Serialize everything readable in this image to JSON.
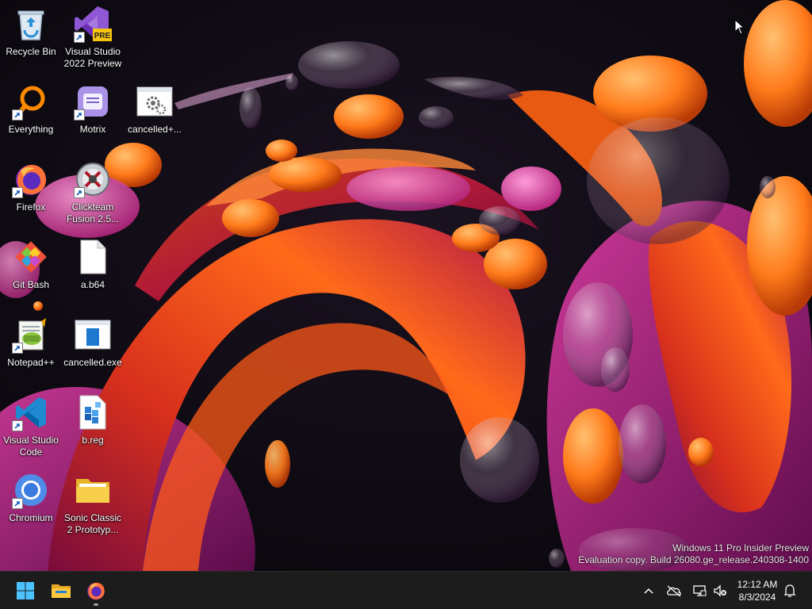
{
  "desktop": {
    "icons": [
      {
        "id": "recycle-bin",
        "label": "Recycle Bin",
        "icon": "recycle-bin-icon"
      },
      {
        "id": "visual-studio-2022-preview",
        "label": "Visual Studio 2022 Preview",
        "icon": "visual-studio-preview-icon",
        "badge": "PRE"
      },
      {
        "id": "everything",
        "label": "Everything",
        "icon": "everything-search-icon"
      },
      {
        "id": "motrix",
        "label": "Motrix",
        "icon": "motrix-icon"
      },
      {
        "id": "cancelled-plus",
        "label": "cancelled+...",
        "icon": "settings-file-icon"
      },
      {
        "id": "firefox",
        "label": "Firefox",
        "icon": "firefox-icon"
      },
      {
        "id": "clickteam-fusion",
        "label": "Clickteam Fusion 2.5...",
        "icon": "clickteam-fusion-icon"
      },
      {
        "id": "git-bash",
        "label": "Git Bash",
        "icon": "git-bash-icon"
      },
      {
        "id": "a-b64",
        "label": "a.b64",
        "icon": "blank-file-icon"
      },
      {
        "id": "notepad-plus-plus",
        "label": "Notepad++",
        "icon": "notepad-plus-plus-icon"
      },
      {
        "id": "cancelled-exe",
        "label": "cancelled.exe",
        "icon": "exe-window-icon"
      },
      {
        "id": "visual-studio-code",
        "label": "Visual Studio Code",
        "icon": "vscode-icon"
      },
      {
        "id": "b-reg",
        "label": "b.reg",
        "icon": "registry-file-icon"
      },
      {
        "id": "chromium",
        "label": "Chromium",
        "icon": "chromium-icon"
      },
      {
        "id": "sonic-classic",
        "label": "Sonic Classic 2 Prototyp...",
        "icon": "folder-icon"
      }
    ]
  },
  "watermark": {
    "line1": "Windows 11 Pro Insider Preview",
    "line2": "Evaluation copy. Build 26080.ge_release.240308-1400"
  },
  "taskbar": {
    "pinned": [
      {
        "name": "start-button",
        "icon": "windows-logo-icon"
      },
      {
        "name": "file-explorer-button",
        "icon": "folder-icon"
      },
      {
        "name": "firefox-taskbar-button",
        "icon": "firefox-icon",
        "active": true
      }
    ],
    "tray": [
      {
        "name": "show-hidden-icons-button",
        "icon": "chevron-up-icon"
      },
      {
        "name": "onedrive-status",
        "icon": "cloud-offline-icon"
      },
      {
        "name": "network-status",
        "icon": "network-icon"
      },
      {
        "name": "volume-status",
        "icon": "speaker-muted-icon"
      }
    ],
    "clock": {
      "time": "12:12 AM",
      "date": "8/3/2024"
    },
    "notifications": {
      "icon": "bell-icon"
    }
  },
  "colors": {
    "taskbar_bg": "#1c1c1c",
    "windows_blue": "#4cc2ff",
    "wallpaper_bg": "#0b0a10"
  }
}
